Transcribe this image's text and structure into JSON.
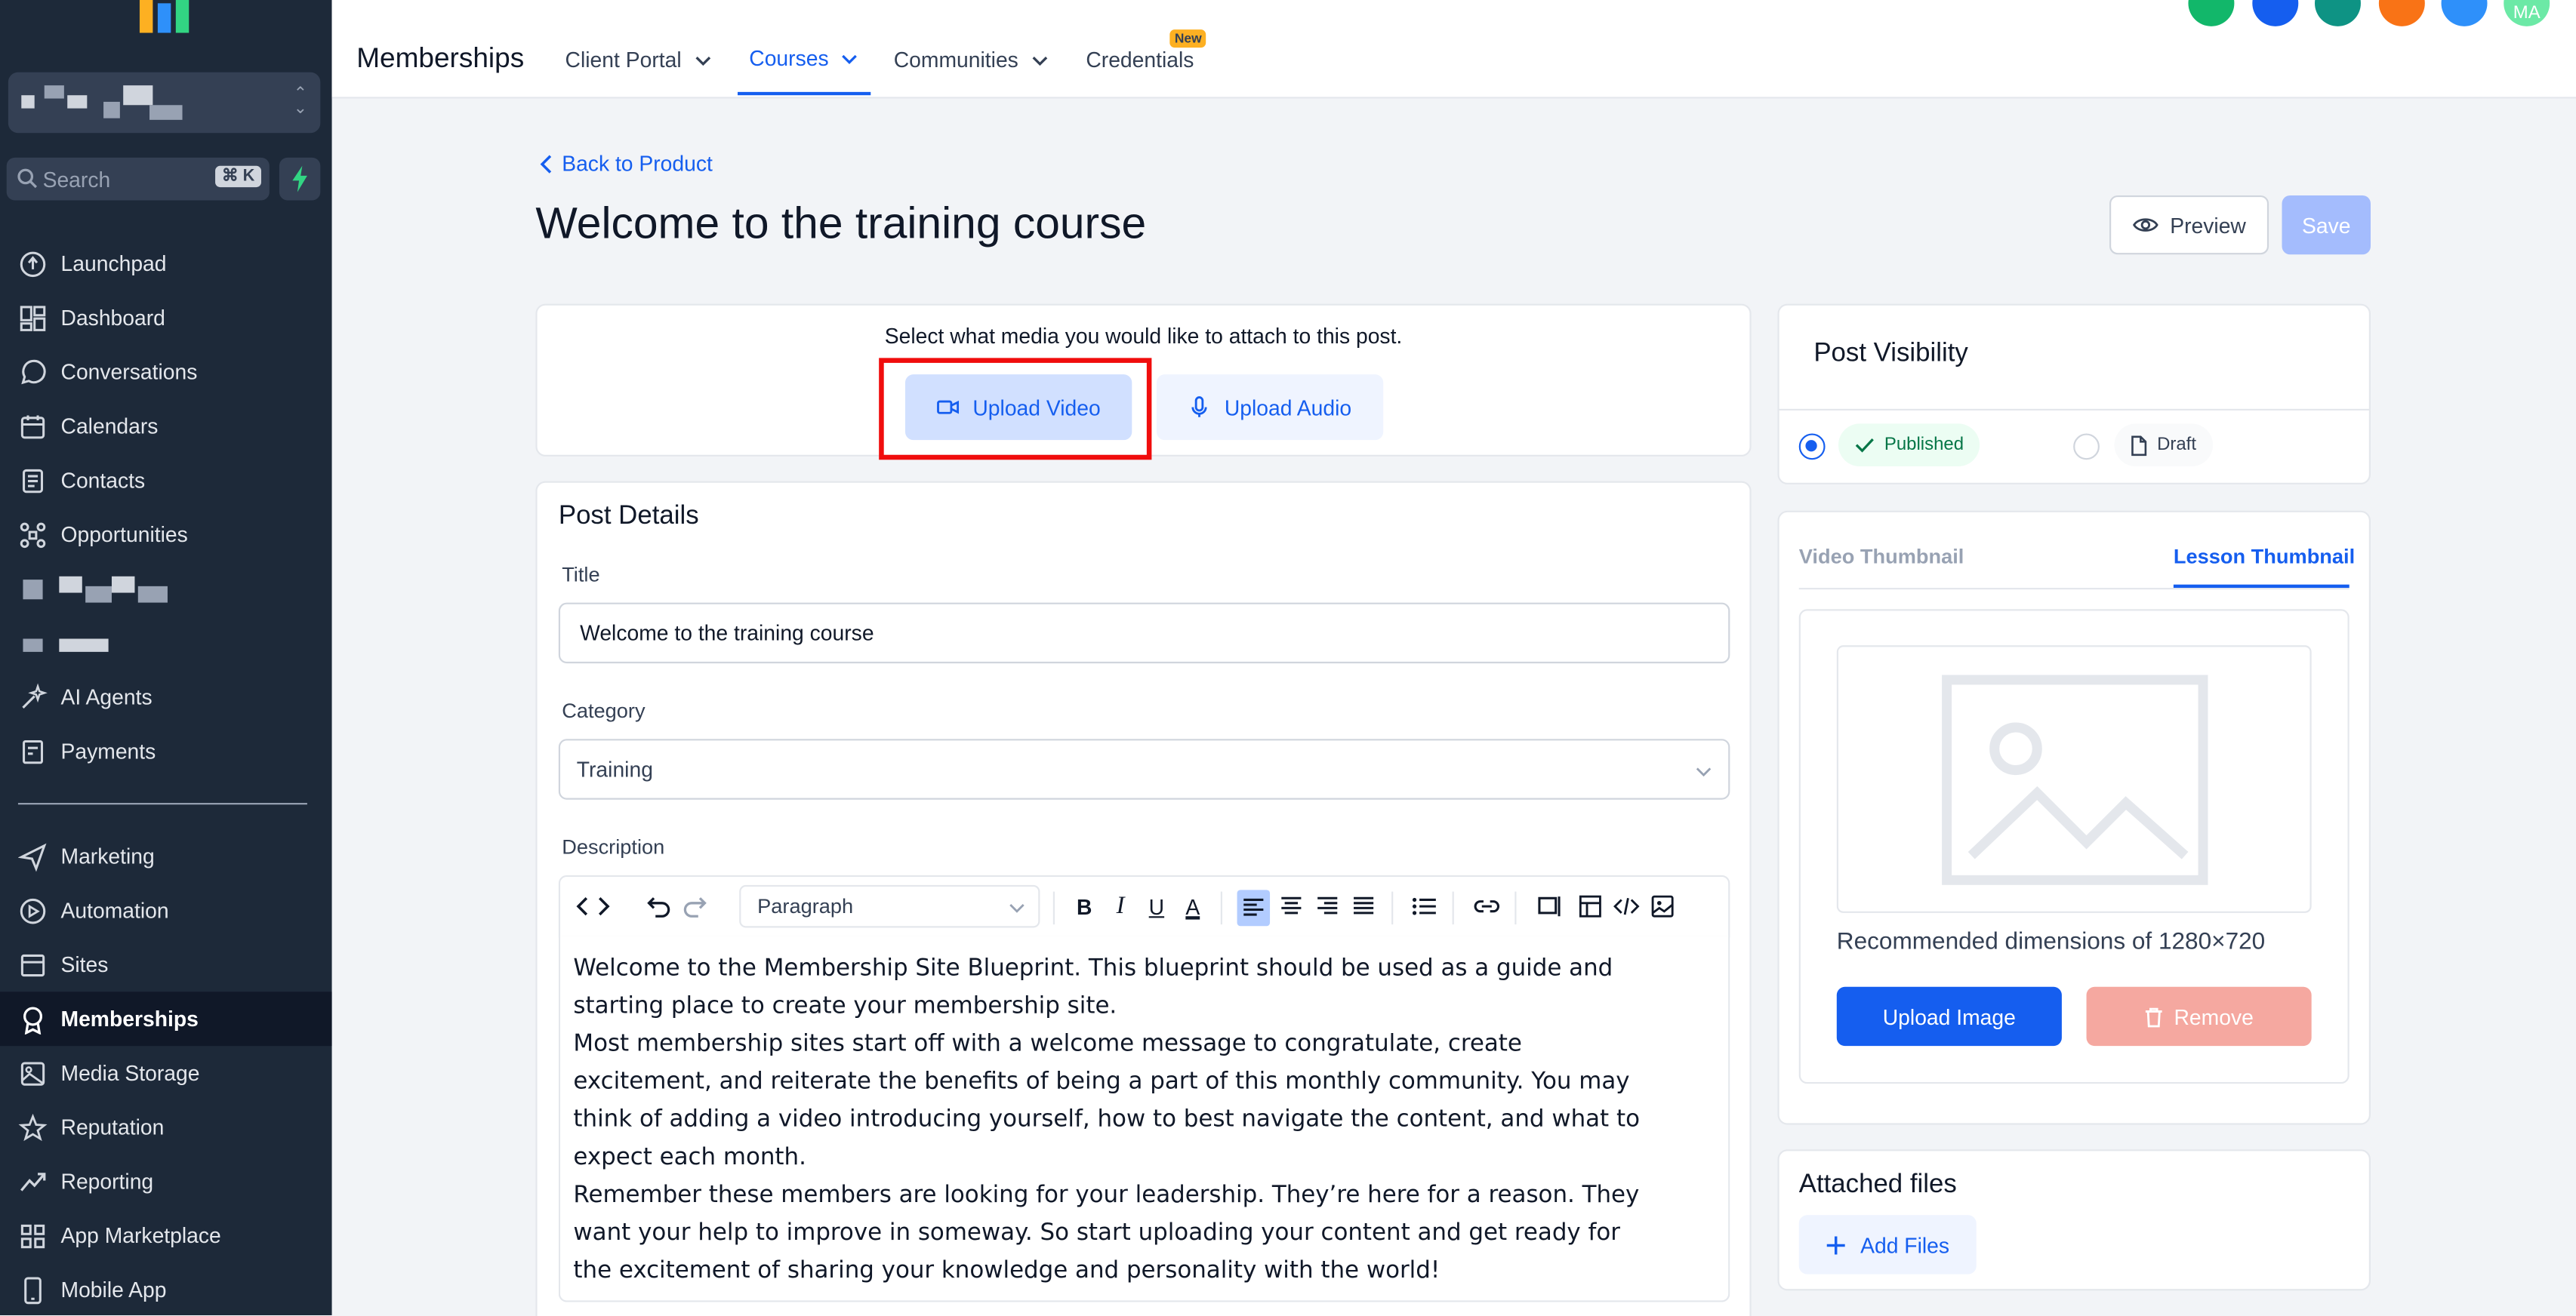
{
  "sidebar": {
    "search": {
      "placeholder": "Search",
      "shortcut": "⌘ K"
    },
    "items": [
      {
        "label": "Launchpad",
        "icon": "rocket-icon"
      },
      {
        "label": "Dashboard",
        "icon": "dashboard-icon"
      },
      {
        "label": "Conversations",
        "icon": "chat-icon"
      },
      {
        "label": "Calendars",
        "icon": "calendar-icon"
      },
      {
        "label": "Contacts",
        "icon": "contacts-icon"
      },
      {
        "label": "Opportunities",
        "icon": "opportunities-icon"
      },
      {
        "label": "AI Agents",
        "icon": "ai-agents-icon"
      },
      {
        "label": "Payments",
        "icon": "payments-icon"
      },
      {
        "label": "Marketing",
        "icon": "send-icon"
      },
      {
        "label": "Automation",
        "icon": "automation-icon"
      },
      {
        "label": "Sites",
        "icon": "sites-icon"
      },
      {
        "label": "Memberships",
        "icon": "membership-badge-icon"
      },
      {
        "label": "Media Storage",
        "icon": "image-icon"
      },
      {
        "label": "Reputation",
        "icon": "star-icon"
      },
      {
        "label": "Reporting",
        "icon": "trend-icon"
      },
      {
        "label": "App Marketplace",
        "icon": "grid-icon"
      },
      {
        "label": "Mobile App",
        "icon": "phone-icon"
      }
    ],
    "active": "Memberships"
  },
  "header": {
    "title": "Memberships",
    "tabs": [
      {
        "label": "Client Portal"
      },
      {
        "label": "Courses",
        "active": true
      },
      {
        "label": "Communities"
      },
      {
        "label": "Credentials",
        "badge": "New"
      }
    ],
    "avatar_initials": "MA"
  },
  "page": {
    "back_label": "Back to Product",
    "title": "Welcome to the training course",
    "preview_label": "Preview",
    "save_label": "Save"
  },
  "media": {
    "prompt": "Select what media you would like to attach to this post.",
    "upload_video": "Upload Video",
    "upload_audio": "Upload Audio"
  },
  "post_details": {
    "heading": "Post Details",
    "title_label": "Title",
    "title_value": "Welcome to the training course",
    "category_label": "Category",
    "category_value": "Training",
    "description_label": "Description",
    "paragraph_style": "Paragraph",
    "description_lines": [
      "Welcome to the Membership Site Blueprint. This blueprint should be used as a guide and",
      "starting place to create your membership site.",
      "Most membership sites start off with a welcome message to congratulate, create",
      "excitement, and reiterate the benefits of being a part of this monthly community. You may",
      "think of adding a video introducing yourself, how to best navigate the content, and what to",
      "expect each month.",
      "Remember these members are looking for your leadership. They’re here for a reason. They",
      "want your help to improve in someway. So start uploading your content and get ready for",
      "the excitement of sharing your knowledge and personality with the world!"
    ]
  },
  "visibility": {
    "heading": "Post Visibility",
    "published_label": "Published",
    "draft_label": "Draft",
    "selected": "Published"
  },
  "thumbnail": {
    "tabs": [
      "Video Thumbnail",
      "Lesson Thumbnail"
    ],
    "active_tab": "Lesson Thumbnail",
    "recommendation": "Recommended dimensions of 1280×720",
    "upload_label": "Upload Image",
    "remove_label": "Remove"
  },
  "attached": {
    "heading": "Attached files",
    "add_label": "Add Files"
  },
  "colors": {
    "accent": "#155eef",
    "sidebar_bg": "#1d2939",
    "highlight_box": "#f00d0d"
  }
}
